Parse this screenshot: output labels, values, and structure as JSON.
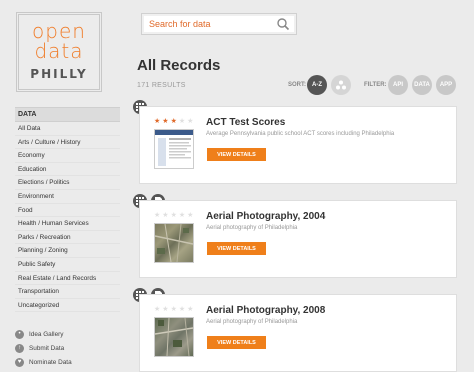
{
  "logo": {
    "line1": "open",
    "line2": "data",
    "line3": "PHILLY"
  },
  "search": {
    "placeholder": "Search for data"
  },
  "page": {
    "title": "All Records",
    "count": "171 RESULTS"
  },
  "sort": {
    "label": "SORT:",
    "az": "A-Z"
  },
  "filter": {
    "label": "FILTER:",
    "api": "API",
    "data": "DATA",
    "app": "APP"
  },
  "sidebar": {
    "heading": "DATA",
    "items": [
      "All Data",
      "Arts / Culture / History",
      "Economy",
      "Education",
      "Elections / Politics",
      "Environment",
      "Food",
      "Health / Human Services",
      "Parks / Recreation",
      "Planning / Zoning",
      "Public Safety",
      "Real Estate / Land Records",
      "Transportation",
      "Uncategorized"
    ]
  },
  "extras": [
    "Idea Gallery",
    "Submit Data",
    "Nominate Data"
  ],
  "records": [
    {
      "title": "ACT Test Scores",
      "description": "Average Pennsylvania public school ACT scores including Philadelphia",
      "button": "VIEW DETAILS",
      "rating": 3
    },
    {
      "title": "Aerial Photography, 2004",
      "description": "Aerial photography of Philadelphia",
      "button": "VIEW DETAILS",
      "rating": 0
    },
    {
      "title": "Aerial Photography, 2008",
      "description": "Aerial photography of Philadelphia",
      "button": "VIEW DETAILS",
      "rating": 0
    }
  ],
  "colors": {
    "accent": "#ef7f1a",
    "background": "#ebebeb"
  }
}
